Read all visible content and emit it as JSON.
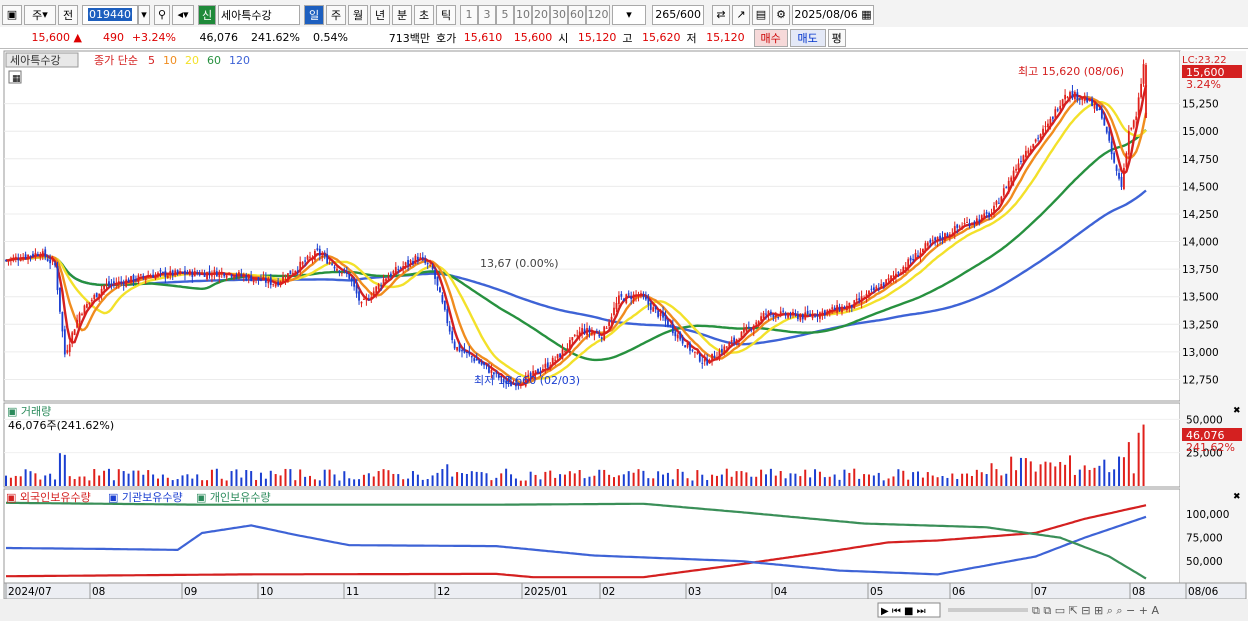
{
  "toolbar": {
    "market_label": "주",
    "prev_label": "전",
    "code": "019440",
    "name": "세아특수강",
    "shin_label": "신",
    "periods": [
      "일",
      "주",
      "월",
      "년",
      "분",
      "초",
      "틱"
    ],
    "selected_period": "일",
    "intervals": [
      "1",
      "3",
      "5",
      "10",
      "20",
      "30",
      "60",
      "120"
    ],
    "count": "265",
    "count_max": "/600",
    "date": "2025/08/06"
  },
  "quote": {
    "price": "15,600",
    "arrow": "▲",
    "change": "490",
    "change_pct": "+3.24%",
    "volume": "46,076",
    "vol_ratio": "241.62%",
    "turnover_pct": "0.54%",
    "amount": "713백만",
    "ask_label": "호가",
    "ask": "15,610",
    "bid": "15,600",
    "open_label": "시",
    "open": "15,120",
    "high_label": "고",
    "high": "15,620",
    "low_label": "저",
    "low": "15,120",
    "buy_label": "매수",
    "sell_label": "매도",
    "flat_label": "평"
  },
  "legend": {
    "name": "세아특수강",
    "ma_title": "종가 단순",
    "ma_periods": [
      "5",
      "10",
      "20",
      "60",
      "120"
    ]
  },
  "colors": {
    "up": "#e0201b",
    "down": "#1b3fd1",
    "ma5": "#d42020",
    "ma10": "#f08c1e",
    "ma20": "#f3e12a",
    "ma60": "#27913f",
    "ma120": "#3e63d6",
    "foreign": "#d42020",
    "inst": "#3e63d6",
    "indiv": "#3a8f58"
  },
  "annotations": {
    "high_label": "최고 15,620 (08/06)",
    "low_label": "최저 12,660 (02/03)",
    "mid_label": "13,67 (0.00%)",
    "lc_label": "LC:23.22",
    "price_tag": "15,600",
    "pct_tag": "3.24%"
  },
  "volume_panel": {
    "title": "거래량",
    "summary": "46,076주(241.62%)",
    "ticks": [
      "50,000",
      "25,000"
    ],
    "current": "46,076",
    "pct": "241.62%"
  },
  "holdings_panel": {
    "series": [
      "외국인보유수량",
      "기관보유수량",
      "개인보유수량"
    ],
    "ticks": [
      "100,000",
      "75,000",
      "50,000"
    ]
  },
  "x_labels": [
    "2024/07",
    "08",
    "09",
    "10",
    "11",
    "12",
    "2025/01",
    "02",
    "03",
    "04",
    "05",
    "06",
    "07",
    "08",
    "08/06"
  ],
  "chart_data": {
    "type": "candlestick",
    "price_ticks": [
      15250,
      15000,
      14750,
      14500,
      14250,
      14000,
      13750,
      13500,
      13250,
      13000,
      12750
    ],
    "highest": {
      "value": 15620,
      "date": "08/06"
    },
    "lowest": {
      "value": 12660,
      "date": "02/03"
    },
    "current": 15600,
    "change": 490,
    "change_pct": 3.24,
    "ohlc": {
      "open": 15120,
      "high": 15620,
      "low": 15120,
      "close": 15600
    },
    "volume_current": 46076,
    "segments": [
      [
        0,
        13830
      ],
      [
        14,
        13900
      ],
      [
        20,
        13780
      ],
      [
        24,
        12980
      ],
      [
        30,
        13350
      ],
      [
        40,
        13600
      ],
      [
        60,
        13700
      ],
      [
        90,
        13720
      ],
      [
        110,
        13620
      ],
      [
        127,
        13900
      ],
      [
        140,
        13680
      ],
      [
        145,
        13420
      ],
      [
        155,
        13680
      ],
      [
        168,
        13860
      ],
      [
        174,
        13740
      ],
      [
        179,
        13350
      ],
      [
        183,
        13050
      ],
      [
        192,
        12920
      ],
      [
        205,
        12700
      ],
      [
        213,
        12760
      ],
      [
        225,
        12950
      ],
      [
        235,
        13200
      ],
      [
        243,
        13150
      ],
      [
        250,
        13480
      ],
      [
        258,
        13520
      ],
      [
        268,
        13300
      ],
      [
        278,
        13050
      ],
      [
        285,
        12900
      ],
      [
        297,
        13100
      ],
      [
        310,
        13350
      ],
      [
        325,
        13320
      ],
      [
        345,
        13420
      ],
      [
        360,
        13650
      ],
      [
        375,
        13950
      ],
      [
        390,
        14150
      ],
      [
        402,
        14250
      ],
      [
        415,
        14800
      ],
      [
        425,
        15050
      ],
      [
        432,
        15350
      ],
      [
        440,
        15300
      ],
      [
        447,
        15150
      ],
      [
        452,
        14700
      ],
      [
        455,
        14500
      ],
      [
        458,
        15000
      ],
      [
        461,
        15120
      ],
      [
        464,
        15600
      ]
    ]
  }
}
